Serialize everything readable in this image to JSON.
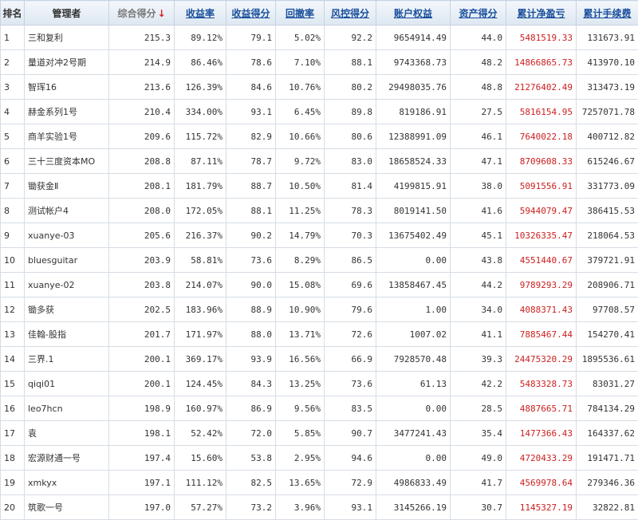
{
  "headers": [
    {
      "label": "排名",
      "name": "col-header-rank",
      "kind": "plain",
      "interactable": false
    },
    {
      "label": "管理者",
      "name": "col-header-manager",
      "kind": "plain",
      "interactable": false
    },
    {
      "label": "综合得分",
      "name": "col-header-overall-score",
      "kind": "sorted",
      "interactable": true,
      "arrow": "↓"
    },
    {
      "label": "收益率",
      "name": "col-header-return-rate",
      "kind": "link",
      "interactable": true
    },
    {
      "label": "收益得分",
      "name": "col-header-return-score",
      "kind": "link",
      "interactable": true
    },
    {
      "label": "回撤率",
      "name": "col-header-drawdown-rate",
      "kind": "link",
      "interactable": true
    },
    {
      "label": "风控得分",
      "name": "col-header-risk-score",
      "kind": "link",
      "interactable": true
    },
    {
      "label": "账户权益",
      "name": "col-header-account-equity",
      "kind": "link",
      "interactable": true
    },
    {
      "label": "资产得分",
      "name": "col-header-asset-score",
      "kind": "link",
      "interactable": true
    },
    {
      "label": "累计净盈亏",
      "name": "col-header-cumulative-net-pnl",
      "kind": "link",
      "interactable": true
    },
    {
      "label": "累计手续费",
      "name": "col-header-cumulative-fees",
      "kind": "link",
      "interactable": true
    }
  ],
  "colors": {
    "pnl_text": "#cc1f1f",
    "header_link": "#1a4f9c",
    "sort_arrow": "#d42020"
  },
  "rows": [
    [
      "1",
      "三和复利",
      "215.3",
      "89.12%",
      "79.1",
      "5.02%",
      "92.2",
      "9654914.49",
      "44.0",
      "5481519.33",
      "131673.91"
    ],
    [
      "2",
      "量道对冲2号期",
      "214.9",
      "86.46%",
      "78.6",
      "7.10%",
      "88.1",
      "9743368.73",
      "48.2",
      "14866865.73",
      "413970.10"
    ],
    [
      "3",
      "智珲16",
      "213.6",
      "126.39%",
      "84.6",
      "10.76%",
      "80.2",
      "29498035.76",
      "48.8",
      "21276402.49",
      "313473.19"
    ],
    [
      "4",
      "赫金系列1号",
      "210.4",
      "334.00%",
      "93.1",
      "6.45%",
      "89.8",
      "819186.91",
      "27.5",
      "5816154.95",
      "7257071.78"
    ],
    [
      "5",
      "商羊实验1号",
      "209.6",
      "115.72%",
      "82.9",
      "10.66%",
      "80.6",
      "12388991.09",
      "46.1",
      "7640022.18",
      "400712.82"
    ],
    [
      "6",
      "三十三度资本MO",
      "208.8",
      "87.11%",
      "78.7",
      "9.72%",
      "83.0",
      "18658524.33",
      "47.1",
      "8709608.33",
      "615246.67"
    ],
    [
      "7",
      "锄获金Ⅱ",
      "208.1",
      "181.79%",
      "88.7",
      "10.50%",
      "81.4",
      "4199815.91",
      "38.0",
      "5091556.91",
      "331773.09"
    ],
    [
      "8",
      "测试帐户4",
      "208.0",
      "172.05%",
      "88.1",
      "11.25%",
      "78.3",
      "8019141.50",
      "41.6",
      "5944079.47",
      "386415.53"
    ],
    [
      "9",
      "xuanye-03",
      "205.6",
      "216.37%",
      "90.2",
      "14.79%",
      "70.3",
      "13675402.49",
      "45.1",
      "10326335.47",
      "218064.53"
    ],
    [
      "10",
      "bluesguitar",
      "203.9",
      "58.81%",
      "73.6",
      "8.29%",
      "86.5",
      "0.00",
      "43.8",
      "4551440.67",
      "379721.91"
    ],
    [
      "11",
      "xuanye-02",
      "203.8",
      "214.07%",
      "90.0",
      "15.08%",
      "69.6",
      "13858467.45",
      "44.2",
      "9789293.29",
      "208906.71"
    ],
    [
      "12",
      "锄多获",
      "202.5",
      "183.96%",
      "88.9",
      "10.90%",
      "79.6",
      "1.00",
      "34.0",
      "4088371.43",
      "97708.57"
    ],
    [
      "13",
      "佳翰-股指",
      "201.7",
      "171.97%",
      "88.0",
      "13.71%",
      "72.6",
      "1007.02",
      "41.1",
      "7885467.44",
      "154270.41"
    ],
    [
      "14",
      "三界.1",
      "200.1",
      "369.17%",
      "93.9",
      "16.56%",
      "66.9",
      "7928570.48",
      "39.3",
      "24475320.29",
      "1895536.61"
    ],
    [
      "15",
      "qiqi01",
      "200.1",
      "124.45%",
      "84.3",
      "13.25%",
      "73.6",
      "61.13",
      "42.2",
      "5483328.73",
      "83031.27"
    ],
    [
      "16",
      "leo7hcn",
      "198.9",
      "160.97%",
      "86.9",
      "9.56%",
      "83.5",
      "0.00",
      "28.5",
      "4887665.71",
      "784134.29"
    ],
    [
      "17",
      "袁",
      "198.1",
      "52.42%",
      "72.0",
      "5.85%",
      "90.7",
      "3477241.43",
      "35.4",
      "1477366.43",
      "164337.62"
    ],
    [
      "18",
      "宏源财通一号",
      "197.4",
      "15.60%",
      "53.8",
      "2.95%",
      "94.6",
      "0.00",
      "49.0",
      "4720433.29",
      "191471.71"
    ],
    [
      "19",
      "xmkyx",
      "197.1",
      "111.12%",
      "82.5",
      "13.65%",
      "72.9",
      "4986833.49",
      "41.7",
      "4569978.64",
      "279346.36"
    ],
    [
      "20",
      "筑歌一号",
      "197.0",
      "57.27%",
      "73.2",
      "3.96%",
      "93.1",
      "3145266.19",
      "30.7",
      "1145327.19",
      "32822.81"
    ]
  ]
}
